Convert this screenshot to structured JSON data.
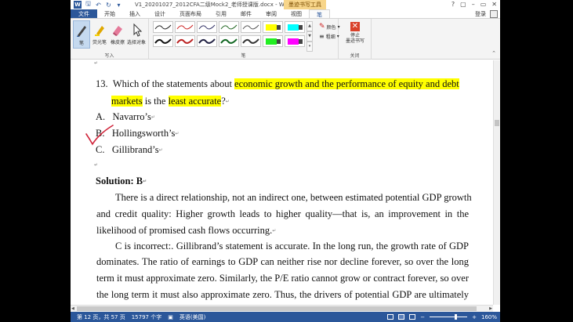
{
  "window": {
    "title": "V1_20201027_2012CFA二级Mock2_老师授课版.docx - Word",
    "context_tab": "墨迹书写工具",
    "controls": [
      "?",
      "▢",
      "–",
      "▭",
      "✕"
    ]
  },
  "tabs": {
    "file": "文件",
    "items": [
      "开始",
      "插入",
      "设计",
      "页面布局",
      "引用",
      "邮件",
      "审阅",
      "视图"
    ],
    "active": "笔",
    "login": "登录"
  },
  "ribbon": {
    "write_group": {
      "label": "写入",
      "buttons": [
        {
          "label": "笔",
          "icon": "pen-icon"
        },
        {
          "label": "荧光笔",
          "icon": "highlighter-icon"
        },
        {
          "label": "橡皮擦",
          "icon": "eraser-icon"
        },
        {
          "label": "选择对象",
          "icon": "select-object-icon"
        }
      ]
    },
    "pens_group": {
      "label": "笔",
      "color_label": "颜色",
      "thickness_label": "粗细"
    },
    "close_group": {
      "label": "关闭",
      "stop_label_1": "停止",
      "stop_label_2": "墨迹书写"
    },
    "colors": {
      "yellow": "#ffff00",
      "cyan": "#00ffff",
      "green": "#22ee22",
      "magenta": "#ff00ff",
      "red": "#d9412a"
    }
  },
  "document": {
    "question_number": "13.",
    "question_line1_plain": "Which of the statements about ",
    "question_line1_hl": "economic growth and the performance of equity and debt",
    "question_line2_hl1": "markets",
    "question_line2_mid": " is the ",
    "question_line2_hl2": "least accurate",
    "question_line2_end": "?",
    "options": [
      {
        "letter": "A.",
        "text": "Navarro’s"
      },
      {
        "letter": "B.",
        "text": "Hollingsworth’s"
      },
      {
        "letter": "C.",
        "text": "Gillibrand’s"
      }
    ],
    "solution_label": "Solution:",
    "solution_answer": "B",
    "para1": [
      "There is a direct relationship, not an indirect one, between estimated potential GDP growth",
      "and credit quality: Higher growth leads to higher quality—that is, an improvement in the",
      "likelihood of promised cash flows occurring."
    ],
    "para2": [
      "C is incorrect:. Gillibrand’s statement is accurate. In the long run, the growth rate of GDP",
      "dominates. The ratio of earnings to GDP can neither rise nor decline forever, so over the long",
      "term it must approximate zero. Similarly, the P/E ratio cannot grow or contract forever, so over",
      "the long term it must also approximate zero. Thus, the drivers of potential GDP are ultimately"
    ]
  },
  "status": {
    "page": "第 12 页，共 57 页",
    "words": "15797 个字",
    "language": "英语(美国)",
    "zoom": "160%"
  }
}
